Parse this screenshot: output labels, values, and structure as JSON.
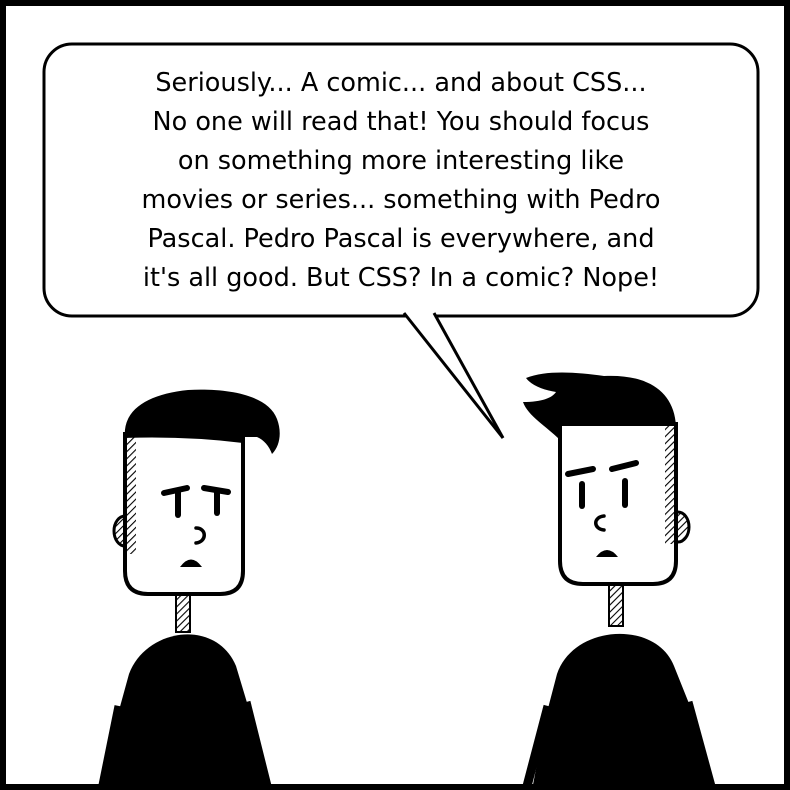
{
  "panel": {
    "dialogue": "Seriously... A comic... and about CSS...\nNo one will read that! You should focus\non something more interesting like\nmovies or series... something with Pedro\nPascal. Pedro Pascal is everywhere, and\nit's all good. But CSS? In a comic? Nope!"
  },
  "characters": {
    "listener": {
      "expression": "worried"
    },
    "speaker": {
      "expression": "annoyed"
    }
  },
  "colors": {
    "ink": "#000000",
    "paper": "#ffffff"
  }
}
